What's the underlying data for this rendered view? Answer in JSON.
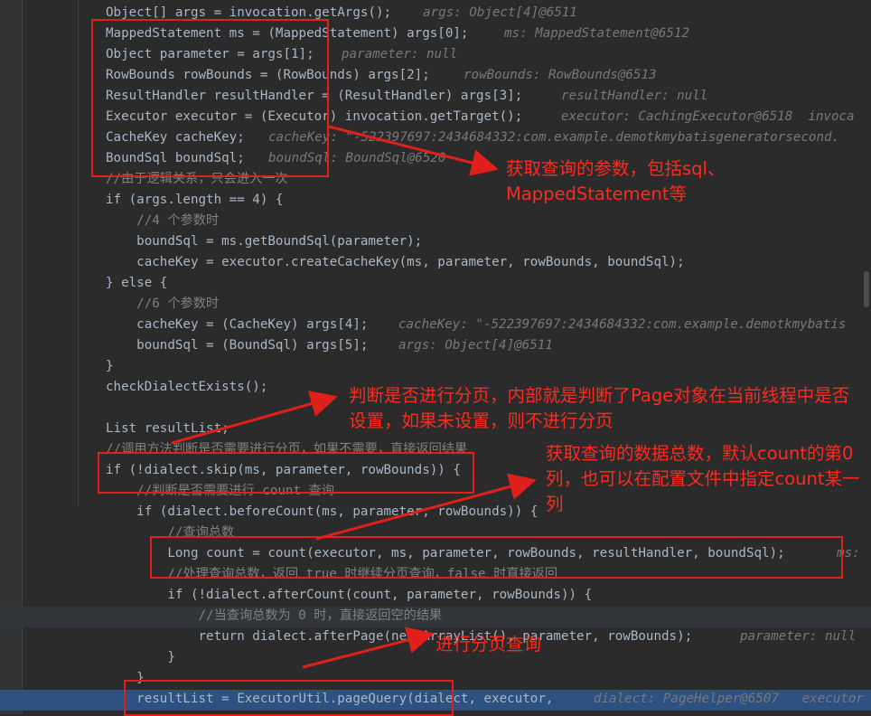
{
  "editor": {
    "lines": [
      {
        "id": "l1",
        "code": "Object[] args = invocation.getArgs();",
        "debug": "args: Object[4]@6511"
      },
      {
        "id": "l2",
        "code": "MappedStatement ms = (MappedStatement) args[0];",
        "debug": "ms: MappedStatement@6512"
      },
      {
        "id": "l3",
        "code": "Object parameter = args[1];",
        "debug": "parameter: null"
      },
      {
        "id": "l4",
        "code": "RowBounds rowBounds = (RowBounds) args[2];",
        "debug": "rowBounds: RowBounds@6513"
      },
      {
        "id": "l5",
        "code": "ResultHandler resultHandler = (ResultHandler) args[3];",
        "debug": "resultHandler: null"
      },
      {
        "id": "l6",
        "code": "Executor executor = (Executor) invocation.getTarget();",
        "debug": "executor: CachingExecutor@6518  invoca"
      },
      {
        "id": "l7",
        "code": "CacheKey cacheKey;",
        "debug": "cacheKey: \"-522397697:2434684332:com.example.demotkmybatisgeneratorsecond."
      },
      {
        "id": "l8",
        "code": "BoundSql boundSql;",
        "debug": "boundSql: BoundSql@6520"
      },
      {
        "id": "l9",
        "code": "//由于逻辑关系，只会进入一次",
        "debug": ""
      },
      {
        "id": "l10",
        "code": "if (args.length == 4) {",
        "debug": ""
      },
      {
        "id": "l11",
        "code": "    //4 个参数时",
        "debug": ""
      },
      {
        "id": "l12",
        "code": "    boundSql = ms.getBoundSql(parameter);",
        "debug": ""
      },
      {
        "id": "l13",
        "code": "    cacheKey = executor.createCacheKey(ms, parameter, rowBounds, boundSql);",
        "debug": ""
      },
      {
        "id": "l14",
        "code": "} else {",
        "debug": ""
      },
      {
        "id": "l15",
        "code": "    //6 个参数时",
        "debug": ""
      },
      {
        "id": "l16",
        "code": "    cacheKey = (CacheKey) args[4];",
        "debug": "cacheKey: \"-522397697:2434684332:com.example.demotkmybatis"
      },
      {
        "id": "l17",
        "code": "    boundSql = (BoundSql) args[5];",
        "debug": "args: Object[4]@6511"
      },
      {
        "id": "l18",
        "code": "}",
        "debug": ""
      },
      {
        "id": "l19",
        "code": "checkDialectExists();",
        "debug": ""
      },
      {
        "id": "l20",
        "code": "",
        "debug": ""
      },
      {
        "id": "l21",
        "code": "List resultList;",
        "debug": ""
      },
      {
        "id": "l22",
        "code": "//调用方法判断是否需要进行分页，如果不需要，直接返回结果",
        "debug": ""
      },
      {
        "id": "l23",
        "code": "if (!dialect.skip(ms, parameter, rowBounds)) {",
        "debug": ""
      },
      {
        "id": "l24",
        "code": "    //判断是否需要进行 count 查询",
        "debug": ""
      },
      {
        "id": "l25",
        "code": "    if (dialect.beforeCount(ms, parameter, rowBounds)) {",
        "debug": ""
      },
      {
        "id": "l26",
        "code": "        //查询总数",
        "debug": ""
      },
      {
        "id": "l27",
        "code": "        Long count = count(executor, ms, parameter, rowBounds, resultHandler, boundSql);",
        "debug": "ms: "
      },
      {
        "id": "l28",
        "code": "        //处理查询总数，返回 true 时继续分页查询，false 时直接返回",
        "debug": ""
      },
      {
        "id": "l29",
        "code": "        if (!dialect.afterCount(count, parameter, rowBounds)) {",
        "debug": ""
      },
      {
        "id": "l30",
        "code": "            //当查询总数为 0 时，直接返回空的结果",
        "debug": ""
      },
      {
        "id": "l31",
        "code": "            return dialect.afterPage(new ArrayList(), parameter, rowBounds);",
        "debug": "parameter: null"
      },
      {
        "id": "l32",
        "code": "        }",
        "debug": ""
      },
      {
        "id": "l33",
        "code": "    }",
        "debug": ""
      },
      {
        "id": "l34",
        "code": "    resultList = ExecutorUtil.pageQuery(dialect, executor,",
        "debug": "dialect: PageHelper@6507   executor"
      }
    ]
  },
  "annotations": {
    "params": "获取查询的参数，包括sql、MappedStatement等",
    "skip": "判断是否进行分页，内部就是判断了Page对象在当前线程中是否设置，如果未设置，则不进行分页",
    "count": "获取查询的数据总数，默认count的第0列，也可以在配置文件中指定count某一列",
    "pagequery": "进行分页查询"
  },
  "colors": {
    "background": "#2b2b2b",
    "keyword": "#cc7832",
    "field": "#9876aa",
    "number": "#6897bb",
    "string": "#6a8759",
    "comment": "#808080",
    "execution_line": "#2d5181",
    "annotation_red": "#ff2a1e"
  }
}
